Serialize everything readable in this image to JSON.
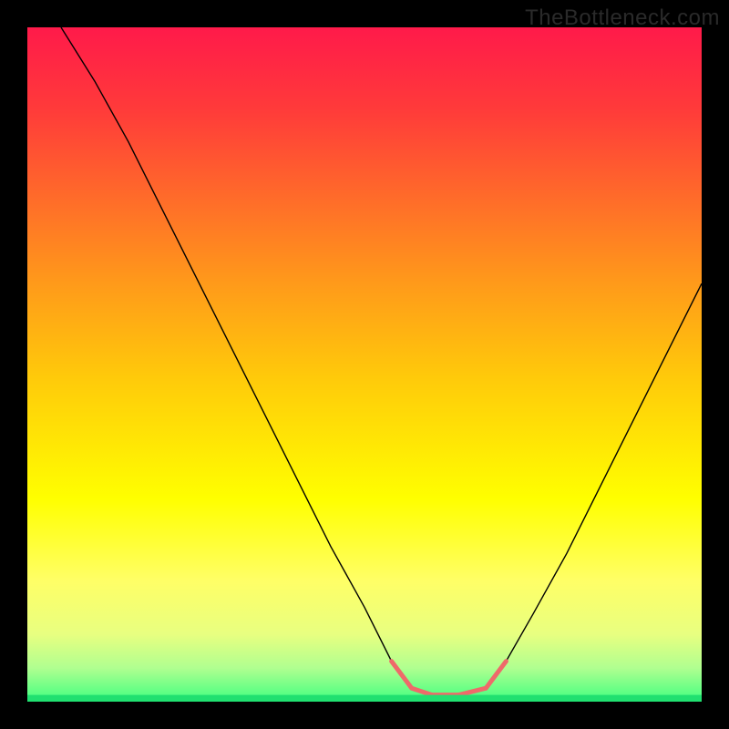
{
  "watermark": "TheBottleneck.com",
  "chart_data": {
    "type": "line",
    "title": "",
    "xlabel": "",
    "ylabel": "",
    "xlim": [
      0,
      100
    ],
    "ylim": [
      0,
      100
    ],
    "curve": {
      "description": "Black penalty curve descending from top-left to a trough near x≈60 then rising toward the right",
      "points": [
        {
          "x": 5,
          "y": 100
        },
        {
          "x": 10,
          "y": 92
        },
        {
          "x": 15,
          "y": 83
        },
        {
          "x": 20,
          "y": 73
        },
        {
          "x": 25,
          "y": 63
        },
        {
          "x": 30,
          "y": 53
        },
        {
          "x": 35,
          "y": 43
        },
        {
          "x": 40,
          "y": 33
        },
        {
          "x": 45,
          "y": 23
        },
        {
          "x": 50,
          "y": 14
        },
        {
          "x": 54,
          "y": 6
        },
        {
          "x": 57,
          "y": 2
        },
        {
          "x": 60,
          "y": 1
        },
        {
          "x": 64,
          "y": 1
        },
        {
          "x": 68,
          "y": 2
        },
        {
          "x": 71,
          "y": 6
        },
        {
          "x": 75,
          "y": 13
        },
        {
          "x": 80,
          "y": 22
        },
        {
          "x": 85,
          "y": 32
        },
        {
          "x": 90,
          "y": 42
        },
        {
          "x": 95,
          "y": 52
        },
        {
          "x": 100,
          "y": 62
        }
      ]
    },
    "highlight_band": {
      "color": "#ee6a6a",
      "segments": [
        {
          "x0": 54,
          "y0": 6,
          "x1": 57,
          "y1": 2
        },
        {
          "x0": 57,
          "y0": 2,
          "x1": 60,
          "y1": 1
        },
        {
          "x0": 60,
          "y0": 1,
          "x1": 64,
          "y1": 1
        },
        {
          "x0": 64,
          "y0": 1,
          "x1": 68,
          "y1": 2
        },
        {
          "x0": 68,
          "y0": 2,
          "x1": 71,
          "y1": 6
        }
      ]
    },
    "bottom_stripe_color": "#20e070"
  }
}
